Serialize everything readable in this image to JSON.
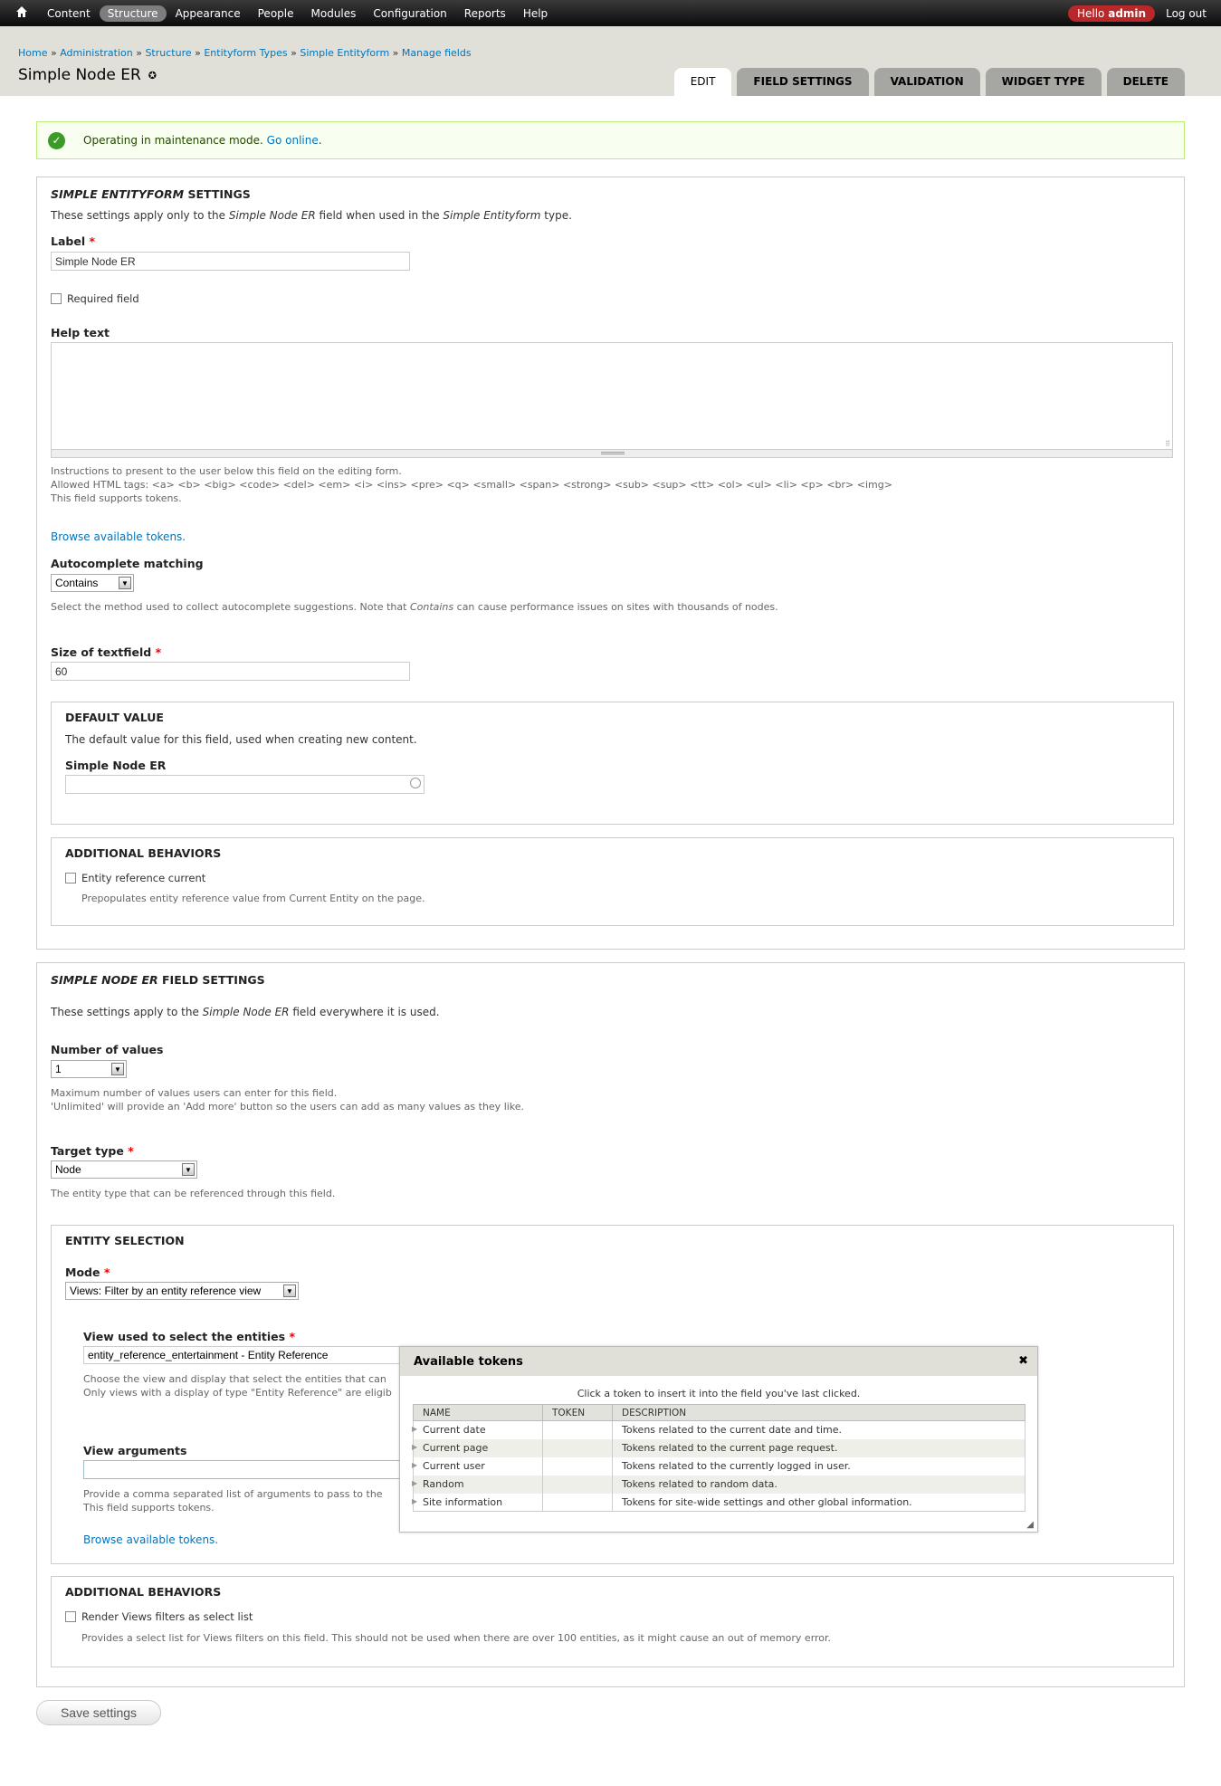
{
  "toolbar": {
    "menu": [
      "Content",
      "Structure",
      "Appearance",
      "People",
      "Modules",
      "Configuration",
      "Reports",
      "Help"
    ],
    "active": "Structure",
    "hello": "Hello",
    "user": "admin",
    "logout": "Log out"
  },
  "breadcrumb": [
    "Home",
    "Administration",
    "Structure",
    "Entityform Types",
    "Simple Entityform",
    "Manage fields"
  ],
  "page_title": "Simple Node ER",
  "tabs": [
    "EDIT",
    "FIELD SETTINGS",
    "VALIDATION",
    "WIDGET TYPE",
    "DELETE"
  ],
  "message": {
    "text": "Operating in maintenance mode.",
    "link": "Go online",
    "suffix": "."
  },
  "instance": {
    "legend_em": "SIMPLE ENTITYFORM",
    "legend_rest": "SETTINGS",
    "intro_pre": "These settings apply only to the",
    "intro_field": "Simple Node ER",
    "intro_mid": "field when used in the",
    "intro_type": "Simple Entityform",
    "intro_post": "type.",
    "label_label": "Label",
    "label_value": "Simple Node ER",
    "required_label": "Required field",
    "help_label": "Help text",
    "help_desc_1": "Instructions to present to the user below this field on the editing form.",
    "help_desc_2": "Allowed HTML tags: <a> <b> <big> <code> <del> <em> <i> <ins> <pre> <q> <small> <span> <strong> <sub> <sup> <tt> <ol> <ul> <li> <p> <br> <img>",
    "help_desc_3": "This field supports tokens.",
    "browse_tokens": "Browse available tokens.",
    "autocomplete_label": "Autocomplete matching",
    "autocomplete_value": "Contains",
    "autocomplete_desc_pre": "Select the method used to collect autocomplete suggestions. Note that",
    "autocomplete_desc_em": "Contains",
    "autocomplete_desc_post": "can cause performance issues on sites with thousands of nodes.",
    "size_label": "Size of textfield",
    "size_value": "60",
    "default_legend": "DEFAULT VALUE",
    "default_desc": "The default value for this field, used when creating new content.",
    "default_field_label": "Simple Node ER",
    "behaviors_legend": "ADDITIONAL BEHAVIORS",
    "erc_label": "Entity reference current",
    "erc_desc": "Prepopulates entity reference value from Current Entity on the page."
  },
  "field": {
    "legend_em": "SIMPLE NODE ER",
    "legend_rest": "FIELD SETTINGS",
    "intro_pre": "These settings apply to the",
    "intro_field": "Simple Node ER",
    "intro_post": "field everywhere it is used.",
    "num_label": "Number of values",
    "num_value": "1",
    "num_desc_1": "Maximum number of values users can enter for this field.",
    "num_desc_2": "'Unlimited' will provide an 'Add more' button so the users can add as many values as they like.",
    "target_label": "Target type",
    "target_value": "Node",
    "target_desc": "The entity type that can be referenced through this field.",
    "selection_legend": "ENTITY SELECTION",
    "mode_label": "Mode",
    "mode_value": "Views: Filter by an entity reference view",
    "view_label": "View used to select the entities",
    "view_value": "entity_reference_entertainment - Entity Reference",
    "view_desc_1": "Choose the view and display that select the entities that can",
    "view_desc_2": "Only views with a display of type \"Entity Reference\" are eligib",
    "args_label": "View arguments",
    "args_desc_1": "Provide a comma separated list of arguments to pass to the",
    "args_desc_2": "This field supports tokens.",
    "browse_tokens": "Browse available tokens.",
    "behaviors_legend": "ADDITIONAL BEHAVIORS",
    "render_label": "Render Views filters as select list",
    "render_desc": "Provides a select list for Views filters on this field. This should not be used when there are over 100 entities, as it might cause an out of memory error."
  },
  "tokens_dialog": {
    "title": "Available tokens",
    "hint": "Click a token to insert it into the field you've last clicked.",
    "columns": [
      "NAME",
      "TOKEN",
      "DESCRIPTION"
    ],
    "rows": [
      {
        "name": "Current date",
        "token": "",
        "desc": "Tokens related to the current date and time."
      },
      {
        "name": "Current page",
        "token": "",
        "desc": "Tokens related to the current page request."
      },
      {
        "name": "Current user",
        "token": "",
        "desc": "Tokens related to the currently logged in user."
      },
      {
        "name": "Random",
        "token": "",
        "desc": "Tokens related to random data."
      },
      {
        "name": "Site information",
        "token": "",
        "desc": "Tokens for site-wide settings and other global information."
      }
    ]
  },
  "save_label": "Save settings"
}
